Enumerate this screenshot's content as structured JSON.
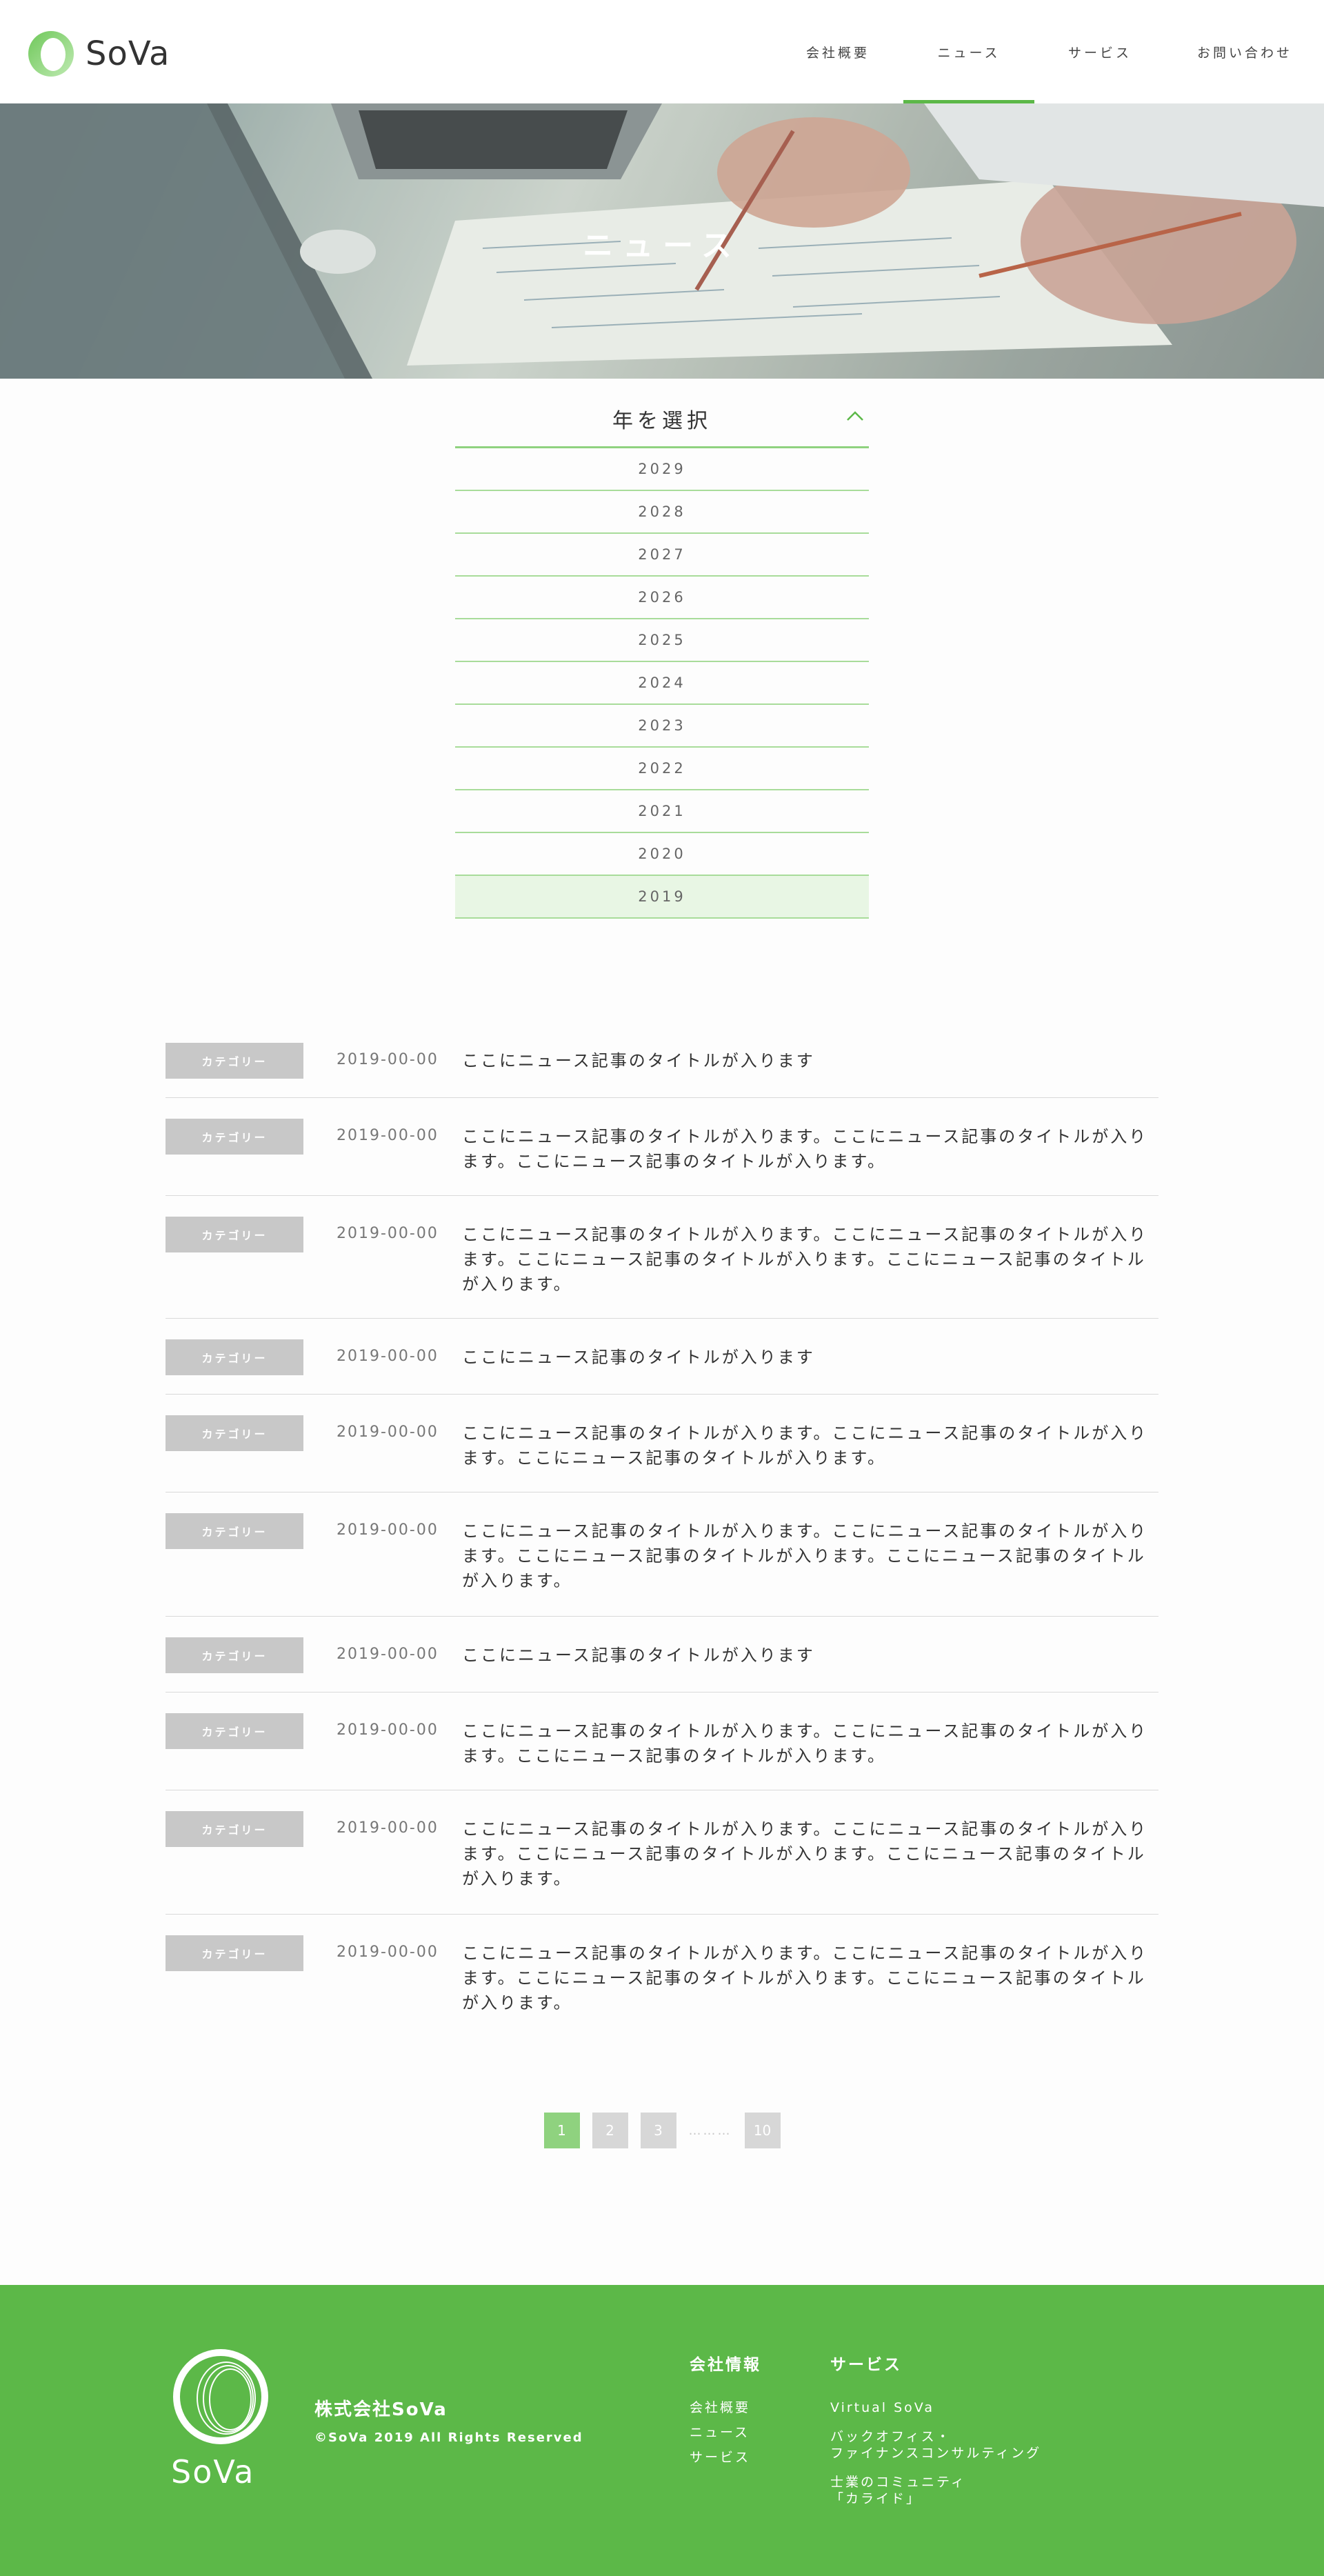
{
  "brand": {
    "name": "SoVa",
    "accent": "#5cb848",
    "accent_light": "#8fd27f"
  },
  "nav": {
    "items": [
      {
        "label": "会社概要"
      },
      {
        "label": "ニュース",
        "active": true
      },
      {
        "label": "サービス"
      },
      {
        "label": "お問い合わせ"
      }
    ]
  },
  "hero": {
    "title": "ニュース"
  },
  "year_select": {
    "heading": "年を選択",
    "years": [
      "2029",
      "2028",
      "2027",
      "2026",
      "2025",
      "2024",
      "2023",
      "2022",
      "2021",
      "2020",
      "2019"
    ],
    "selected": "2019"
  },
  "news": {
    "items": [
      {
        "category": "カテゴリー",
        "date": "2019-00-00",
        "title": "ここにニュース記事のタイトルが入ります"
      },
      {
        "category": "カテゴリー",
        "date": "2019-00-00",
        "title": "ここにニュース記事のタイトルが入ります。ここにニュース記事のタイトルが入ります。ここにニュース記事のタイトルが入ります。"
      },
      {
        "category": "カテゴリー",
        "date": "2019-00-00",
        "title": "ここにニュース記事のタイトルが入ります。ここにニュース記事のタイトルが入ります。ここにニュース記事のタイトルが入ります。ここにニュース記事のタイトルが入ります。"
      },
      {
        "category": "カテゴリー",
        "date": "2019-00-00",
        "title": "ここにニュース記事のタイトルが入ります"
      },
      {
        "category": "カテゴリー",
        "date": "2019-00-00",
        "title": "ここにニュース記事のタイトルが入ります。ここにニュース記事のタイトルが入ります。ここにニュース記事のタイトルが入ります。"
      },
      {
        "category": "カテゴリー",
        "date": "2019-00-00",
        "title": "ここにニュース記事のタイトルが入ります。ここにニュース記事のタイトルが入ります。ここにニュース記事のタイトルが入ります。ここにニュース記事のタイトルが入ります。"
      },
      {
        "category": "カテゴリー",
        "date": "2019-00-00",
        "title": "ここにニュース記事のタイトルが入ります"
      },
      {
        "category": "カテゴリー",
        "date": "2019-00-00",
        "title": "ここにニュース記事のタイトルが入ります。ここにニュース記事のタイトルが入ります。ここにニュース記事のタイトルが入ります。"
      },
      {
        "category": "カテゴリー",
        "date": "2019-00-00",
        "title": "ここにニュース記事のタイトルが入ります。ここにニュース記事のタイトルが入ります。ここにニュース記事のタイトルが入ります。ここにニュース記事のタイトルが入ります。"
      },
      {
        "category": "カテゴリー",
        "date": "2019-00-00",
        "title": "ここにニュース記事のタイトルが入ります。ここにニュース記事のタイトルが入ります。ここにニュース記事のタイトルが入ります。ここにニュース記事のタイトルが入ります。"
      }
    ]
  },
  "pagination": {
    "pages": [
      "1",
      "2",
      "3"
    ],
    "current": "1",
    "ellipsis": "………",
    "last": "10"
  },
  "footer": {
    "company_name": "株式会社SoVa",
    "copyright": "©SoVa 2019 All Rights Reserved",
    "logo_text": "SoVa",
    "col1": {
      "heading": "会社情報",
      "links": [
        "会社概要",
        "ニュース",
        "サービス"
      ]
    },
    "col2": {
      "heading": "サービス",
      "links": [
        "Virtual SoVa",
        "バックオフィス・\nファイナンスコンサルティング",
        "士業のコミュニティ\n「カライド」"
      ]
    }
  }
}
